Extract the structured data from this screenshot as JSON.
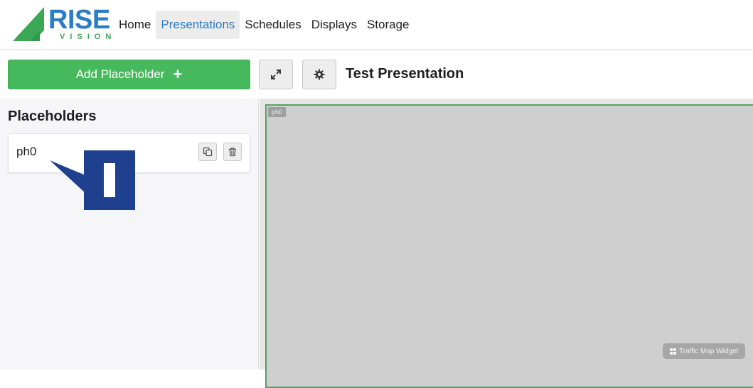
{
  "brand": {
    "name_top": "RISE",
    "name_bottom": "VISION",
    "colors": {
      "blue": "#2b7dc5",
      "green": "#3aa857"
    }
  },
  "nav": {
    "items": [
      {
        "label": "Home",
        "active": false
      },
      {
        "label": "Presentations",
        "active": true
      },
      {
        "label": "Schedules",
        "active": false
      },
      {
        "label": "Displays",
        "active": false
      },
      {
        "label": "Storage",
        "active": false
      }
    ]
  },
  "toolbar": {
    "add_label": "Add Placeholder",
    "add_icon": "plus-icon",
    "expand_icon": "expand-icon",
    "settings_icon": "gear-icon",
    "presentation_title": "Test Presentation",
    "accent": "#46b95d"
  },
  "sidebar": {
    "heading": "Placeholders",
    "placeholders": [
      {
        "name": "ph0",
        "actions": [
          "duplicate-icon",
          "trash-icon"
        ]
      }
    ]
  },
  "canvas": {
    "placeholder_tag": "ph0",
    "widget_label": "Traffic Map Widget",
    "widget_icon": "grid-icon",
    "border_color": "#5a9e67"
  },
  "annotation": {
    "icon": "text-cursor-icon",
    "color": "#1f3f8f"
  }
}
